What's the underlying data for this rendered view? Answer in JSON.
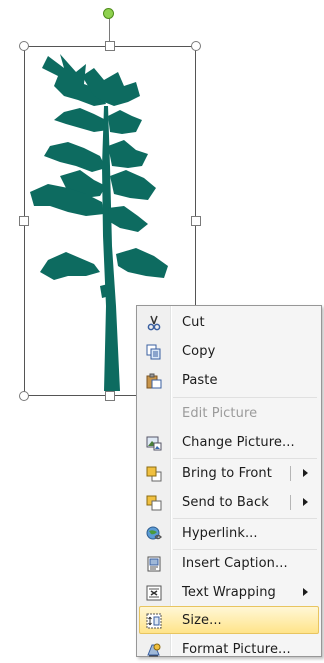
{
  "picture": {
    "description_icon": "pine-tree-silhouette",
    "tree_color": "#0d6b60"
  },
  "context_menu": {
    "items": [
      {
        "label": "Cut",
        "icon": "scissors-icon",
        "enabled": true
      },
      {
        "label": "Copy",
        "icon": "copy-icon",
        "enabled": true
      },
      {
        "label": "Paste",
        "icon": "paste-icon",
        "enabled": true
      },
      {
        "label": "Edit Picture",
        "icon": "",
        "enabled": false
      },
      {
        "label": "Change Picture...",
        "icon": "change-picture-icon",
        "enabled": true
      },
      {
        "label": "Bring to Front",
        "icon": "bring-to-front-icon",
        "enabled": true,
        "submenu": true
      },
      {
        "label": "Send to Back",
        "icon": "send-to-back-icon",
        "enabled": true,
        "submenu": true
      },
      {
        "label": "Hyperlink...",
        "icon": "hyperlink-globe-icon",
        "enabled": true
      },
      {
        "label": "Insert Caption...",
        "icon": "insert-caption-icon",
        "enabled": true
      },
      {
        "label": "Text Wrapping",
        "icon": "text-wrapping-icon",
        "enabled": true,
        "submenu": true
      },
      {
        "label": "Size...",
        "icon": "size-icon",
        "enabled": true,
        "highlighted": true
      },
      {
        "label": "Format Picture...",
        "icon": "format-picture-icon",
        "enabled": true
      }
    ],
    "highlight_color": "#ffe48a"
  }
}
